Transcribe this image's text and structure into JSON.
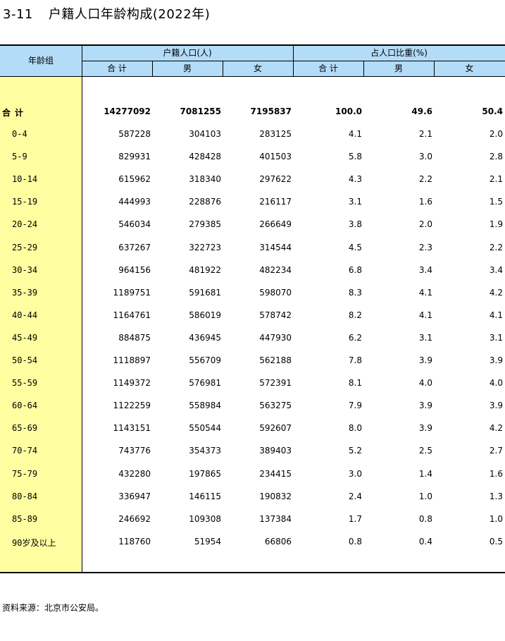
{
  "title": {
    "number": "3-11",
    "text": "户籍人口年龄构成(2022年)"
  },
  "header": {
    "age_group": "年龄组",
    "registered_population": "户籍人口(人)",
    "share_of_population": "占人口比重(%)",
    "total": "合 计",
    "male": "男",
    "female": "女"
  },
  "total_row": {
    "label": "合计",
    "values": [
      "14277092",
      "7081255",
      "7195837",
      "100.0",
      "49.6",
      "50.4"
    ]
  },
  "rows": [
    {
      "label": "0-4",
      "values": [
        "587228",
        "304103",
        "283125",
        "4.1",
        "2.1",
        "2.0"
      ]
    },
    {
      "label": "5-9",
      "values": [
        "829931",
        "428428",
        "401503",
        "5.8",
        "3.0",
        "2.8"
      ]
    },
    {
      "label": "10-14",
      "values": [
        "615962",
        "318340",
        "297622",
        "4.3",
        "2.2",
        "2.1"
      ]
    },
    {
      "label": "15-19",
      "values": [
        "444993",
        "228876",
        "216117",
        "3.1",
        "1.6",
        "1.5"
      ]
    },
    {
      "label": "20-24",
      "values": [
        "546034",
        "279385",
        "266649",
        "3.8",
        "2.0",
        "1.9"
      ]
    },
    {
      "label": "25-29",
      "values": [
        "637267",
        "322723",
        "314544",
        "4.5",
        "2.3",
        "2.2"
      ]
    },
    {
      "label": "30-34",
      "values": [
        "964156",
        "481922",
        "482234",
        "6.8",
        "3.4",
        "3.4"
      ]
    },
    {
      "label": "35-39",
      "values": [
        "1189751",
        "591681",
        "598070",
        "8.3",
        "4.1",
        "4.2"
      ]
    },
    {
      "label": "40-44",
      "values": [
        "1164761",
        "586019",
        "578742",
        "8.2",
        "4.1",
        "4.1"
      ]
    },
    {
      "label": "45-49",
      "values": [
        "884875",
        "436945",
        "447930",
        "6.2",
        "3.1",
        "3.1"
      ]
    },
    {
      "label": "50-54",
      "values": [
        "1118897",
        "556709",
        "562188",
        "7.8",
        "3.9",
        "3.9"
      ]
    },
    {
      "label": "55-59",
      "values": [
        "1149372",
        "576981",
        "572391",
        "8.1",
        "4.0",
        "4.0"
      ]
    },
    {
      "label": "60-64",
      "values": [
        "1122259",
        "558984",
        "563275",
        "7.9",
        "3.9",
        "3.9"
      ]
    },
    {
      "label": "65-69",
      "values": [
        "1143151",
        "550544",
        "592607",
        "8.0",
        "3.9",
        "4.2"
      ]
    },
    {
      "label": "70-74",
      "values": [
        "743776",
        "354373",
        "389403",
        "5.2",
        "2.5",
        "2.7"
      ]
    },
    {
      "label": "75-79",
      "values": [
        "432280",
        "197865",
        "234415",
        "3.0",
        "1.4",
        "1.6"
      ]
    },
    {
      "label": "80-84",
      "values": [
        "336947",
        "146115",
        "190832",
        "2.4",
        "1.0",
        "1.3"
      ]
    },
    {
      "label": "85-89",
      "values": [
        "246692",
        "109308",
        "137384",
        "1.7",
        "0.8",
        "1.0"
      ]
    },
    {
      "label": "90岁及以上",
      "values": [
        "118760",
        "51954",
        "66806",
        "0.8",
        "0.4",
        "0.5"
      ]
    }
  ],
  "source": "资料来源：北京市公安局。",
  "colors": {
    "header_bg": "#b3dcf8",
    "label_col_bg": "#fffea0"
  }
}
